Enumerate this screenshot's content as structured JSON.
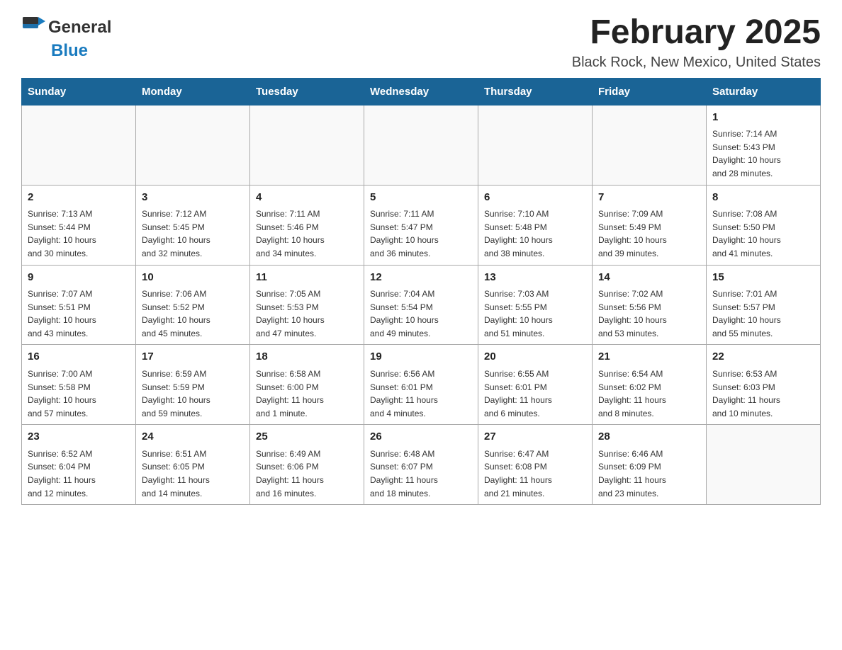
{
  "header": {
    "logo_general": "General",
    "logo_blue": "Blue",
    "month_title": "February 2025",
    "location": "Black Rock, New Mexico, United States"
  },
  "days_of_week": [
    "Sunday",
    "Monday",
    "Tuesday",
    "Wednesday",
    "Thursday",
    "Friday",
    "Saturday"
  ],
  "weeks": [
    [
      {
        "day": "",
        "info": ""
      },
      {
        "day": "",
        "info": ""
      },
      {
        "day": "",
        "info": ""
      },
      {
        "day": "",
        "info": ""
      },
      {
        "day": "",
        "info": ""
      },
      {
        "day": "",
        "info": ""
      },
      {
        "day": "1",
        "info": "Sunrise: 7:14 AM\nSunset: 5:43 PM\nDaylight: 10 hours\nand 28 minutes."
      }
    ],
    [
      {
        "day": "2",
        "info": "Sunrise: 7:13 AM\nSunset: 5:44 PM\nDaylight: 10 hours\nand 30 minutes."
      },
      {
        "day": "3",
        "info": "Sunrise: 7:12 AM\nSunset: 5:45 PM\nDaylight: 10 hours\nand 32 minutes."
      },
      {
        "day": "4",
        "info": "Sunrise: 7:11 AM\nSunset: 5:46 PM\nDaylight: 10 hours\nand 34 minutes."
      },
      {
        "day": "5",
        "info": "Sunrise: 7:11 AM\nSunset: 5:47 PM\nDaylight: 10 hours\nand 36 minutes."
      },
      {
        "day": "6",
        "info": "Sunrise: 7:10 AM\nSunset: 5:48 PM\nDaylight: 10 hours\nand 38 minutes."
      },
      {
        "day": "7",
        "info": "Sunrise: 7:09 AM\nSunset: 5:49 PM\nDaylight: 10 hours\nand 39 minutes."
      },
      {
        "day": "8",
        "info": "Sunrise: 7:08 AM\nSunset: 5:50 PM\nDaylight: 10 hours\nand 41 minutes."
      }
    ],
    [
      {
        "day": "9",
        "info": "Sunrise: 7:07 AM\nSunset: 5:51 PM\nDaylight: 10 hours\nand 43 minutes."
      },
      {
        "day": "10",
        "info": "Sunrise: 7:06 AM\nSunset: 5:52 PM\nDaylight: 10 hours\nand 45 minutes."
      },
      {
        "day": "11",
        "info": "Sunrise: 7:05 AM\nSunset: 5:53 PM\nDaylight: 10 hours\nand 47 minutes."
      },
      {
        "day": "12",
        "info": "Sunrise: 7:04 AM\nSunset: 5:54 PM\nDaylight: 10 hours\nand 49 minutes."
      },
      {
        "day": "13",
        "info": "Sunrise: 7:03 AM\nSunset: 5:55 PM\nDaylight: 10 hours\nand 51 minutes."
      },
      {
        "day": "14",
        "info": "Sunrise: 7:02 AM\nSunset: 5:56 PM\nDaylight: 10 hours\nand 53 minutes."
      },
      {
        "day": "15",
        "info": "Sunrise: 7:01 AM\nSunset: 5:57 PM\nDaylight: 10 hours\nand 55 minutes."
      }
    ],
    [
      {
        "day": "16",
        "info": "Sunrise: 7:00 AM\nSunset: 5:58 PM\nDaylight: 10 hours\nand 57 minutes."
      },
      {
        "day": "17",
        "info": "Sunrise: 6:59 AM\nSunset: 5:59 PM\nDaylight: 10 hours\nand 59 minutes."
      },
      {
        "day": "18",
        "info": "Sunrise: 6:58 AM\nSunset: 6:00 PM\nDaylight: 11 hours\nand 1 minute."
      },
      {
        "day": "19",
        "info": "Sunrise: 6:56 AM\nSunset: 6:01 PM\nDaylight: 11 hours\nand 4 minutes."
      },
      {
        "day": "20",
        "info": "Sunrise: 6:55 AM\nSunset: 6:01 PM\nDaylight: 11 hours\nand 6 minutes."
      },
      {
        "day": "21",
        "info": "Sunrise: 6:54 AM\nSunset: 6:02 PM\nDaylight: 11 hours\nand 8 minutes."
      },
      {
        "day": "22",
        "info": "Sunrise: 6:53 AM\nSunset: 6:03 PM\nDaylight: 11 hours\nand 10 minutes."
      }
    ],
    [
      {
        "day": "23",
        "info": "Sunrise: 6:52 AM\nSunset: 6:04 PM\nDaylight: 11 hours\nand 12 minutes."
      },
      {
        "day": "24",
        "info": "Sunrise: 6:51 AM\nSunset: 6:05 PM\nDaylight: 11 hours\nand 14 minutes."
      },
      {
        "day": "25",
        "info": "Sunrise: 6:49 AM\nSunset: 6:06 PM\nDaylight: 11 hours\nand 16 minutes."
      },
      {
        "day": "26",
        "info": "Sunrise: 6:48 AM\nSunset: 6:07 PM\nDaylight: 11 hours\nand 18 minutes."
      },
      {
        "day": "27",
        "info": "Sunrise: 6:47 AM\nSunset: 6:08 PM\nDaylight: 11 hours\nand 21 minutes."
      },
      {
        "day": "28",
        "info": "Sunrise: 6:46 AM\nSunset: 6:09 PM\nDaylight: 11 hours\nand 23 minutes."
      },
      {
        "day": "",
        "info": ""
      }
    ]
  ]
}
